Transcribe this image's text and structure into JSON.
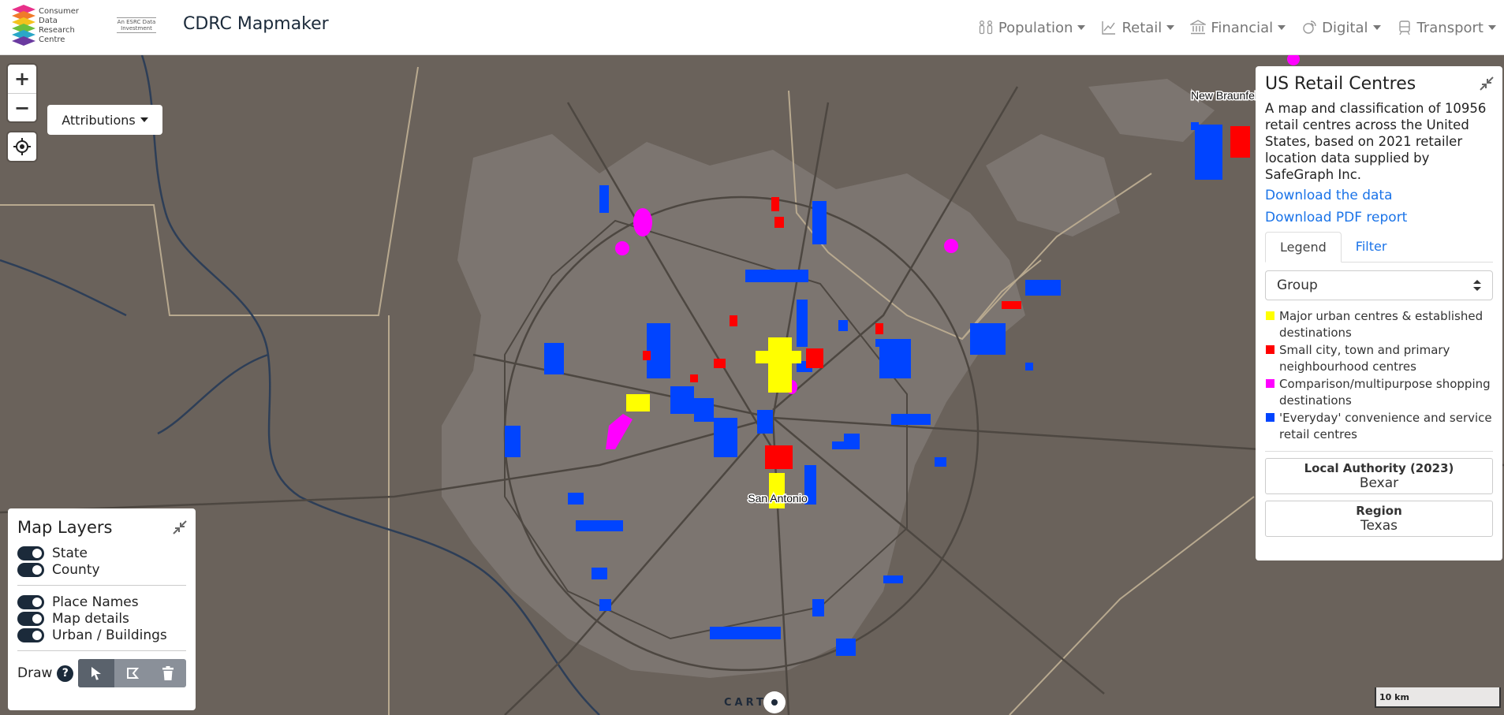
{
  "header": {
    "logo_text": "Consumer\nData\nResearch\nCentre",
    "esrc_text": "An ESRC Data Investment",
    "app_title": "CDRC Mapmaker",
    "nav": [
      {
        "label": "Population",
        "icon": "people-icon"
      },
      {
        "label": "Retail",
        "icon": "chart-icon"
      },
      {
        "label": "Financial",
        "icon": "bank-icon"
      },
      {
        "label": "Digital",
        "icon": "satellite-icon"
      },
      {
        "label": "Transport",
        "icon": "train-icon"
      }
    ]
  },
  "map": {
    "labels": {
      "city": "San Antonio",
      "town": "New Braunfels"
    },
    "attributions_label": "Attributions",
    "zoom_in": "+",
    "zoom_out": "−",
    "carto_label": "CART",
    "scale_label": "10 km"
  },
  "panel": {
    "title": "US Retail Centres",
    "description": "A map and classification of 10956 retail centres across the United States, based on 2021 retailer location data supplied by SafeGraph Inc.",
    "link_data": "Download the data",
    "link_pdf": "Download PDF report",
    "tabs": [
      "Legend",
      "Filter"
    ],
    "select_value": "Group",
    "legend": [
      {
        "label": "Major urban centres & established destinations",
        "color": "#ffff00"
      },
      {
        "label": "Small city, town and primary neighbourhood centres",
        "color": "#ff0000"
      },
      {
        "label": "Comparison/multipurpose shopping destinations",
        "color": "#ff00ff"
      },
      {
        "label": "'Everyday' convenience and service retail centres",
        "color": "#0044ff"
      }
    ],
    "local_authority_heading": "Local Authority (2023)",
    "local_authority_value": "Bexar",
    "region_heading": "Region",
    "region_value": "Texas"
  },
  "layers": {
    "title": "Map Layers",
    "group1": [
      "State",
      "County"
    ],
    "group2": [
      "Place Names",
      "Map details",
      "Urban / Buildings"
    ],
    "draw_label": "Draw",
    "help": "?"
  }
}
